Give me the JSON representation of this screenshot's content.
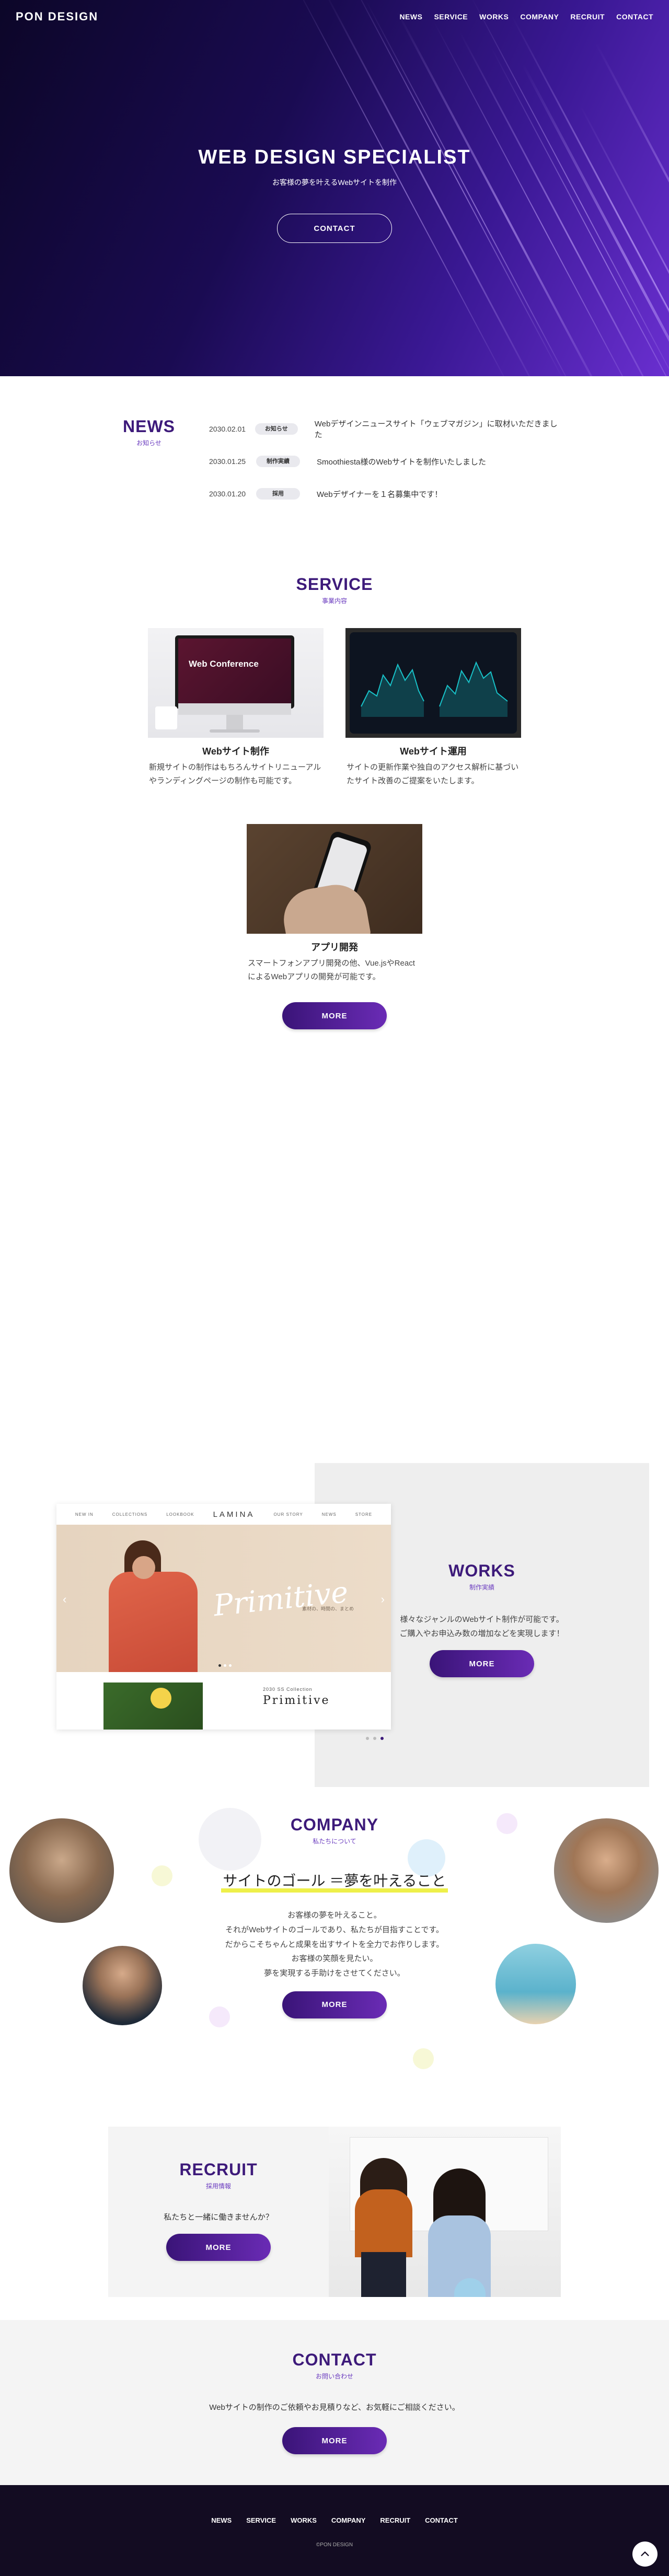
{
  "header": {
    "logo": "PON DESIGN",
    "nav": [
      "NEWS",
      "SERVICE",
      "WORKS",
      "COMPANY",
      "RECRUIT",
      "CONTACT"
    ]
  },
  "hero": {
    "title": "WEB DESIGN SPECIALIST",
    "subtitle": "お客様の夢を叶えるWebサイトを制作",
    "button": "CONTACT"
  },
  "news": {
    "title": "NEWS",
    "subtitle": "お知らせ",
    "items": [
      {
        "date": "2030.02.01",
        "tag": "お知らせ",
        "text": "Webデザインニュースサイト「ウェブマガジン」に取材いただきました"
      },
      {
        "date": "2030.01.25",
        "tag": "制作実績",
        "text": "Smoothiesta様のWebサイトを制作いたしました"
      },
      {
        "date": "2030.01.20",
        "tag": "採用",
        "text": "Webデザイナーを１名募集中です！"
      }
    ]
  },
  "service": {
    "title": "SERVICE",
    "subtitle": "事業内容",
    "items": [
      {
        "title": "Webサイト制作",
        "desc": "新規サイトの制作はもちろんサイトリニューアルやランディングページの制作も可能です。",
        "screen_title": "Web Conference"
      },
      {
        "title": "Webサイト運用",
        "desc": "サイトの更新作業や独自のアクセス解析に基づいたサイト改善のご提案をいたします。"
      },
      {
        "title": "アプリ開発",
        "desc": "スマートフォンアプリ開発の他、Vue.jsやReactによるWebアプリの開発が可能です。"
      }
    ],
    "button": "MORE"
  },
  "works": {
    "title": "WORKS",
    "subtitle": "制作実績",
    "text_line1": "様々なジャンルのWebサイト制作が可能です。",
    "text_line2": "ご購入やお申込み数の増加などを実現します！",
    "button": "MORE",
    "shot": {
      "brand": "LAMINA",
      "nav_left": [
        "NEW IN",
        "COLLECTIONS",
        "LOOKBOOK"
      ],
      "nav_right": [
        "OUR STORY",
        "NEWS",
        "STORE"
      ],
      "script": "Primitive",
      "script_sub": "素材の、時間の、まとめ",
      "collection_label": "2030 SS Collection",
      "collection_title": "Primitive"
    }
  },
  "company": {
    "title": "COMPANY",
    "subtitle": "私たちについて",
    "lead": "サイトのゴール ＝夢を叶えること",
    "lines": [
      "お客様の夢を叶えること。",
      "それがWebサイトのゴールであり、私たちが目指すことです。",
      "だからこそちゃんと成果を出すサイトを全力でお作りします。",
      "お客様の笑顔を見たい。",
      "夢を実現する手助けをさせてください。"
    ],
    "button": "MORE"
  },
  "recruit": {
    "title": "RECRUIT",
    "subtitle": "採用情報",
    "text": "私たちと一緒に働きませんか？",
    "button": "MORE"
  },
  "contact": {
    "title": "CONTACT",
    "subtitle": "お問い合わせ",
    "text": "Webサイトの制作のご依頼やお見積りなど、お気軽にご相談ください。",
    "button": "MORE"
  },
  "footer": {
    "nav": [
      "NEWS",
      "SERVICE",
      "WORKS",
      "COMPANY",
      "RECRUIT",
      "CONTACT"
    ],
    "copyright": "©PON DESIGN"
  },
  "colors": {
    "primary": "#3d1a7a",
    "accent": "#6a2bb5",
    "highlight": "#eef04a",
    "footer_bg": "#130c22"
  },
  "icons": {
    "to_top": "chevron-up-icon",
    "slider_prev": "chevron-left-icon",
    "slider_next": "chevron-right-icon"
  }
}
